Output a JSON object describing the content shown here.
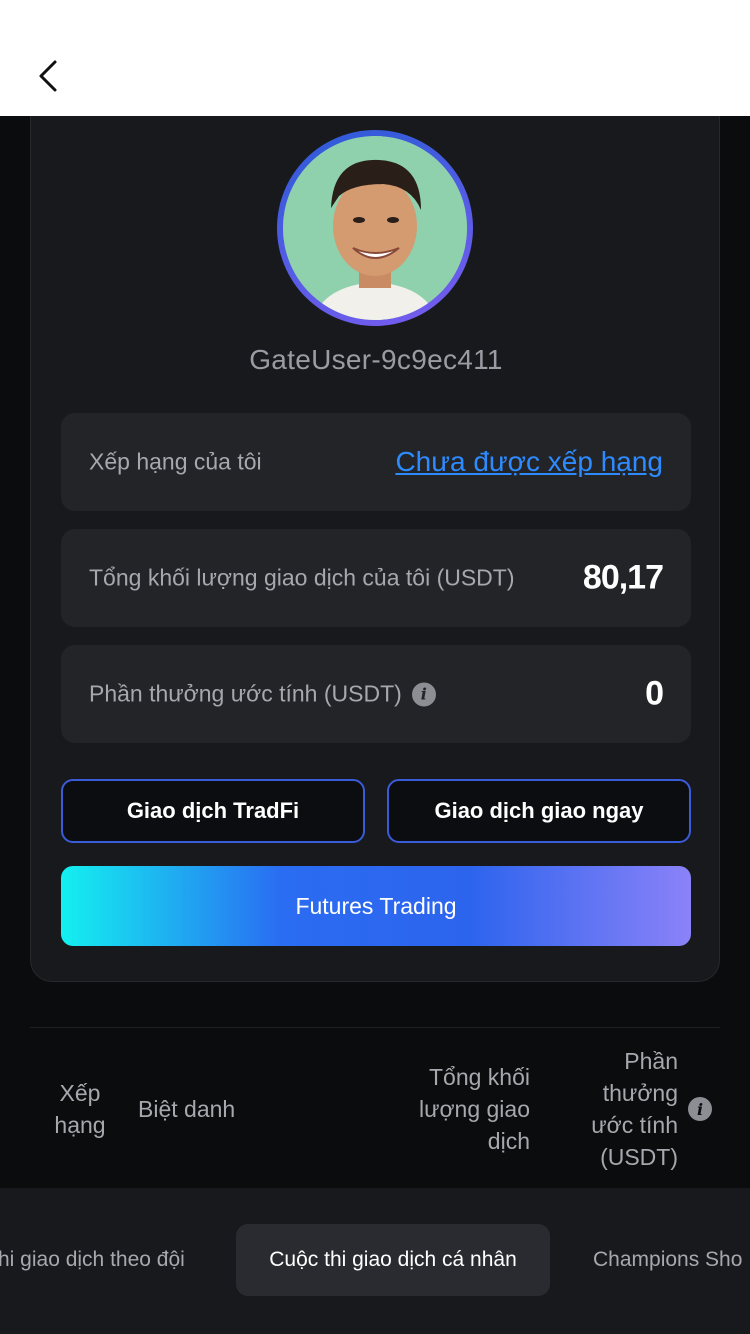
{
  "header": {
    "back_icon": "chevron-left-icon"
  },
  "profile": {
    "username": "GateUser-9c9ec411"
  },
  "stats": {
    "rank_label": "Xếp hạng của tôi",
    "rank_value": "Chưa được xếp hạng",
    "volume_label": "Tổng khối lượng giao dịch của tôi (USDT)",
    "volume_value": "80,17",
    "reward_label": "Phần thưởng ước tính (USDT)",
    "reward_value": "0"
  },
  "buttons": {
    "tradfi": "Giao dịch TradFi",
    "spot": "Giao dịch giao ngay",
    "futures": "Futures Trading"
  },
  "table": {
    "headers": {
      "rank": [
        "Xếp",
        "hạng"
      ],
      "nickname": "Biệt danh",
      "volume": [
        "Tổng khối",
        "lượng giao",
        "dịch"
      ],
      "reward": [
        "Phần",
        "thưởng",
        "ước tính",
        "(USDT)"
      ]
    }
  },
  "tabs": {
    "items": [
      "hi giao dịch theo đội",
      "Cuộc thi giao dịch cá nhân",
      "Champions Sho"
    ],
    "active_index": 1
  },
  "colors": {
    "accent_link": "#2e8bff",
    "card_bg": "#18191c",
    "row_bg": "#232428"
  }
}
